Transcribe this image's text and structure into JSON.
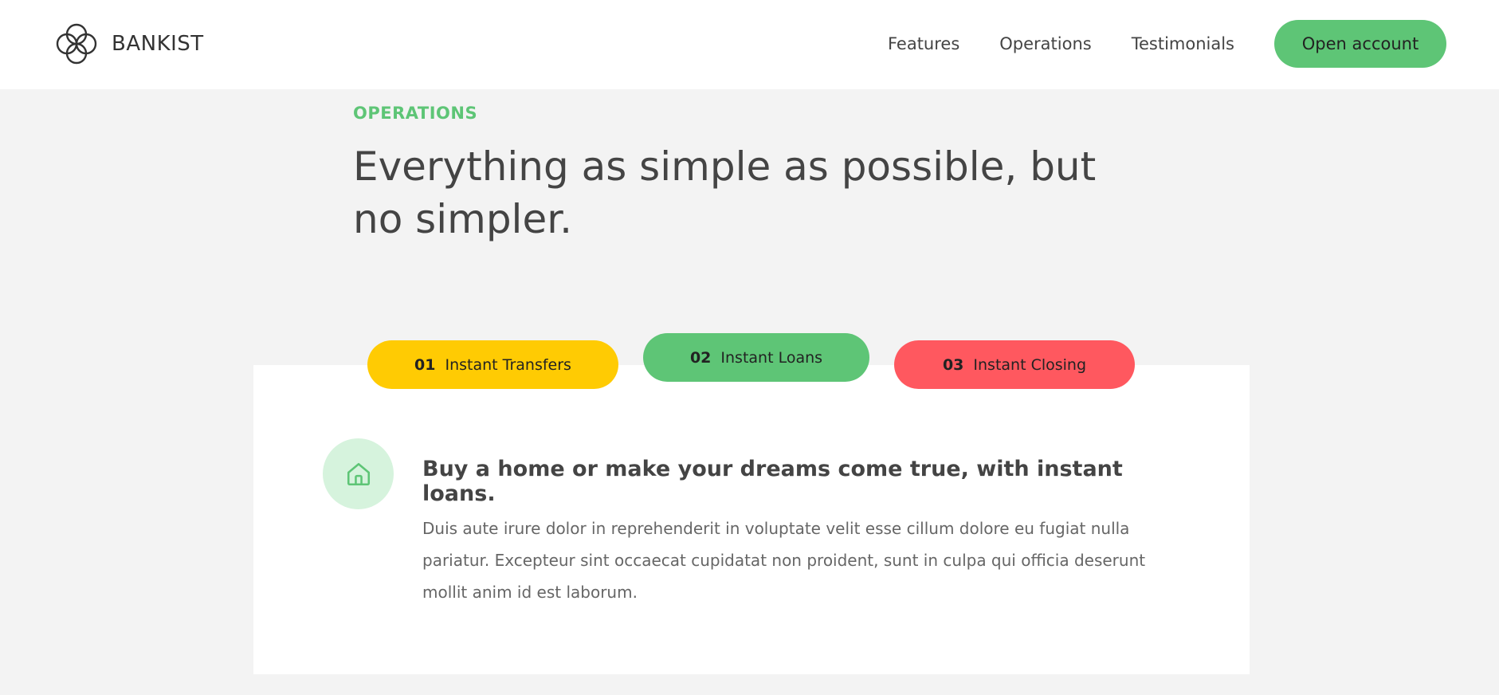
{
  "nav": {
    "logo_text": "BANKIST",
    "links": [
      "Features",
      "Operations",
      "Testimonials"
    ],
    "cta": "Open account"
  },
  "section": {
    "label": "OPERATIONS",
    "headline": "Everything as simple as possible, but no simpler."
  },
  "tabs": [
    {
      "num": "01",
      "label": "Instant Transfers",
      "color": "#ffcb03"
    },
    {
      "num": "02",
      "label": "Instant Loans",
      "color": "#5ec576",
      "active": true
    },
    {
      "num": "03",
      "label": "Instant Closing",
      "color": "#ff585f"
    }
  ],
  "content": {
    "icon": "home-icon",
    "title": "Buy a home or make your dreams come true, with instant loans.",
    "body": "Duis aute irure dolor in reprehenderit in voluptate velit esse cillum dolore eu fugiat nulla pariatur. Excepteur sint occaecat cupidatat non proident, sunt in culpa qui officia deserunt mollit anim id est laborum."
  },
  "colors": {
    "accent": "#5ec576",
    "background": "#f3f3f3",
    "icon_bg": "#d6f3dd"
  }
}
